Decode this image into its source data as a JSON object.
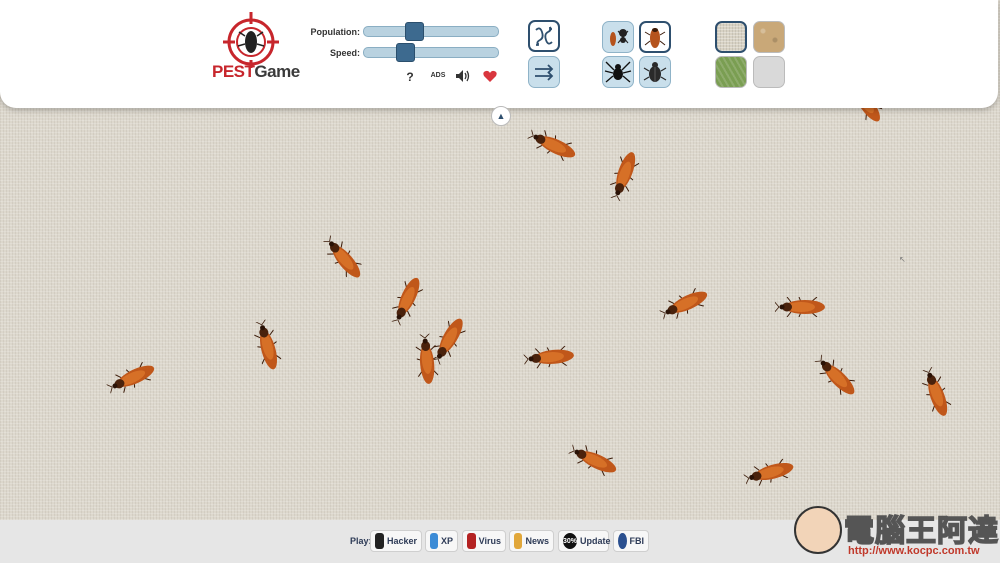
{
  "brand": {
    "logo_a": "PEST",
    "logo_b": "Game",
    "logo_icon": "cockroach-target-icon",
    "accent": "#c7262c"
  },
  "controls": {
    "population_label": "Population:",
    "population_value": 0.35,
    "speed_label": "Speed:",
    "speed_value": 0.27,
    "help_label": "?",
    "ads_label": "ADS",
    "sound_icon": "speaker-icon",
    "like_icon": "heart-icon"
  },
  "modes": [
    {
      "name": "random-move-icon"
    },
    {
      "name": "straight-move-icon"
    }
  ],
  "pests": [
    {
      "name": "cockroach-ant-mix",
      "selected": false
    },
    {
      "name": "cockroach",
      "selected": true
    },
    {
      "name": "spider",
      "selected": false
    },
    {
      "name": "beetle",
      "selected": false
    }
  ],
  "backgrounds": [
    {
      "name": "linen",
      "color": "#d8d2c4",
      "selected": true
    },
    {
      "name": "sand",
      "color": "#c9a878",
      "selected": false
    },
    {
      "name": "grass",
      "color": "#7a9e52",
      "selected": false
    },
    {
      "name": "plain",
      "color": "#d9d9d9",
      "selected": false
    }
  ],
  "bottom": {
    "play_label": "Play:",
    "links": [
      {
        "label": "Hacker",
        "icon": "hacker-icon",
        "color": "#222222"
      },
      {
        "label": "XP",
        "icon": "xp-icon",
        "color": "#3b8bd6"
      },
      {
        "label": "Virus",
        "icon": "virus-icon",
        "color": "#b42222"
      },
      {
        "label": "News",
        "icon": "news-icon",
        "color": "#e1a73a"
      },
      {
        "label": "Update",
        "icon": "update-icon",
        "color": "#111111"
      },
      {
        "label": "FBI",
        "icon": "fbi-icon",
        "color": "#2a4f8f"
      }
    ],
    "update_badge": "30%"
  },
  "watermark": {
    "title": "電腦王阿達",
    "url": "http://www.kocpc.com.tw"
  }
}
